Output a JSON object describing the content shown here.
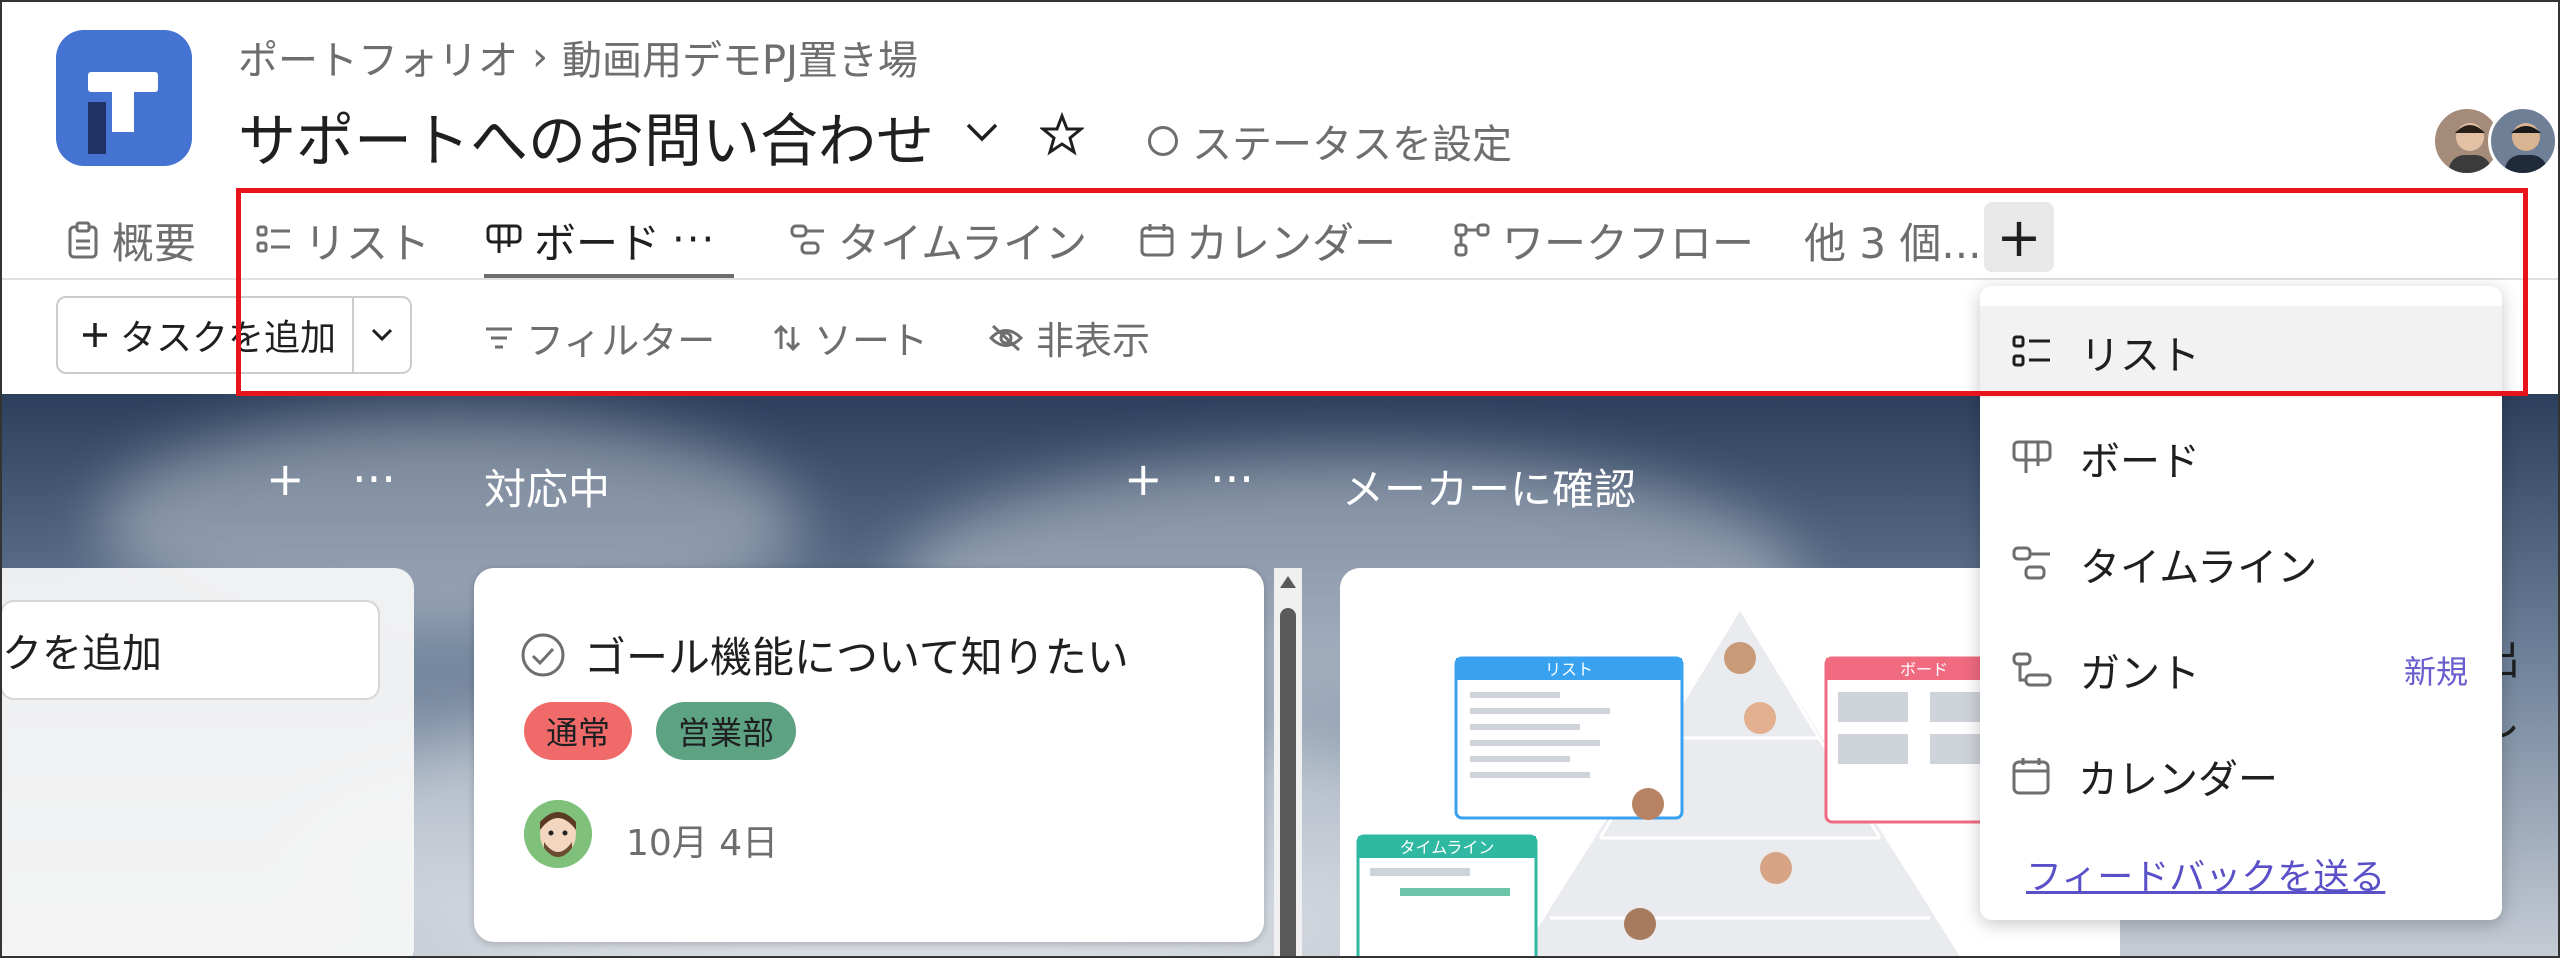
{
  "header": {
    "breadcrumb": {
      "portfolio": "ポートフォリオ",
      "separator": "›",
      "project": "動画用デモPJ置き場"
    },
    "title": "サポートへのお問い合わせ",
    "status_label": "ステータスを設定"
  },
  "tabs": [
    {
      "label": "概要",
      "icon": "clipboard-icon"
    },
    {
      "label": "リスト",
      "icon": "list-icon"
    },
    {
      "label": "ボード",
      "icon": "board-icon",
      "more": "···",
      "active": true
    },
    {
      "label": "タイムライン",
      "icon": "timeline-icon"
    },
    {
      "label": "カレンダー",
      "icon": "calendar-icon"
    },
    {
      "label": "ワークフロー",
      "icon": "workflow-icon"
    },
    {
      "label": "他 3 個..."
    }
  ],
  "add_tab_label": "+",
  "toolbar": {
    "add_task_label": "タスクを追加",
    "filter_label": "フィルター",
    "sort_label": "ソート",
    "hide_label": "非表示"
  },
  "board": {
    "columns": [
      {
        "title": "対応中"
      },
      {
        "title": "メーカーに確認"
      }
    ],
    "left_input_text": "クを追加",
    "col_add": "+",
    "col_more": "···",
    "card": {
      "title": "ゴール機能について知りたい",
      "tags": [
        {
          "label": "通常",
          "color": "#f06a6a"
        },
        {
          "label": "営業部",
          "color": "#5da283"
        }
      ],
      "date": "10月 4日"
    },
    "promo_labels": {
      "list": "リスト",
      "board": "ボード",
      "timeline": "タイムライン"
    },
    "right_partial_text": "出し"
  },
  "menu": {
    "items": [
      {
        "label": "リスト",
        "icon": "list-icon"
      },
      {
        "label": "ボード",
        "icon": "board-icon"
      },
      {
        "label": "タイムライン",
        "icon": "timeline-icon"
      },
      {
        "label": "ガント",
        "icon": "gantt-icon",
        "badge": "新規"
      },
      {
        "label": "カレンダー",
        "icon": "calendar-icon"
      }
    ],
    "feedback_link": "フィードバックを送る"
  },
  "colors": {
    "accent": "#4573d2",
    "highlight": "#e8141c",
    "badge": "#6a5ecf"
  }
}
